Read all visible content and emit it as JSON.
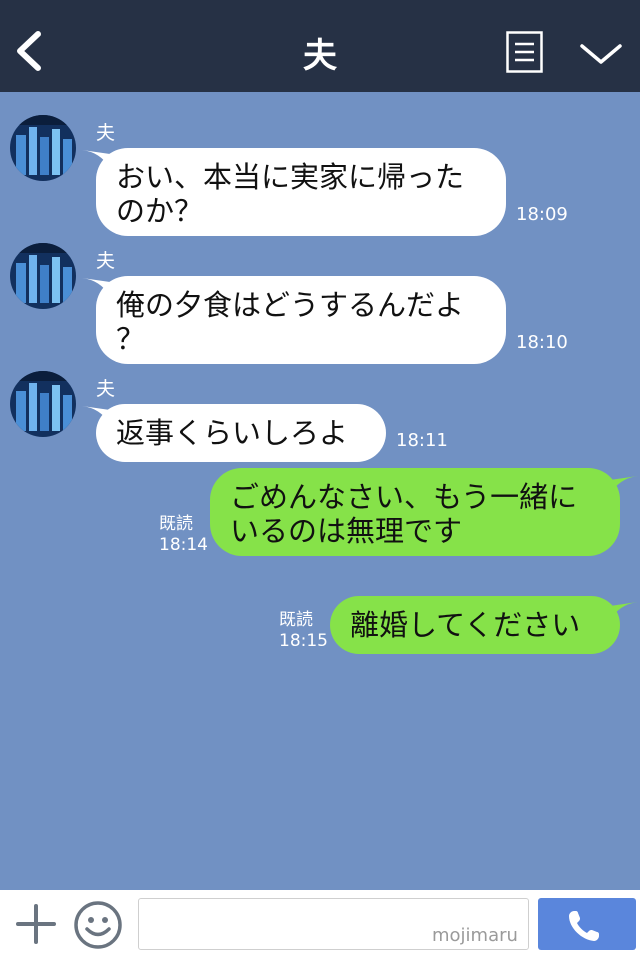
{
  "header": {
    "title": "夫"
  },
  "messages": [
    {
      "sender": "夫",
      "lines": [
        "おい、本当に実家に帰った",
        "のか？"
      ],
      "time": "18:09"
    },
    {
      "sender": "夫",
      "lines": [
        "俺の夕食はどうするんだよ",
        "？"
      ],
      "time": "18:10"
    },
    {
      "sender": "夫",
      "lines": [
        "返事くらいしろよ"
      ],
      "time": "18:11"
    },
    {
      "lines": [
        "ごめんなさい、もう一緒に",
        "いるのは無理です"
      ],
      "read": "既読",
      "time": "18:14"
    },
    {
      "lines": [
        "離婚してください"
      ],
      "read": "既読",
      "time": "18:15"
    }
  ],
  "footer": {
    "input_value": "",
    "watermark": "mojimaru"
  },
  "colors": {
    "header_bg": "#263145",
    "chat_bg": "#7191c3",
    "incoming_bubble": "#ffffff",
    "outgoing_bubble": "#86e249",
    "call_button": "#5a86dc"
  }
}
